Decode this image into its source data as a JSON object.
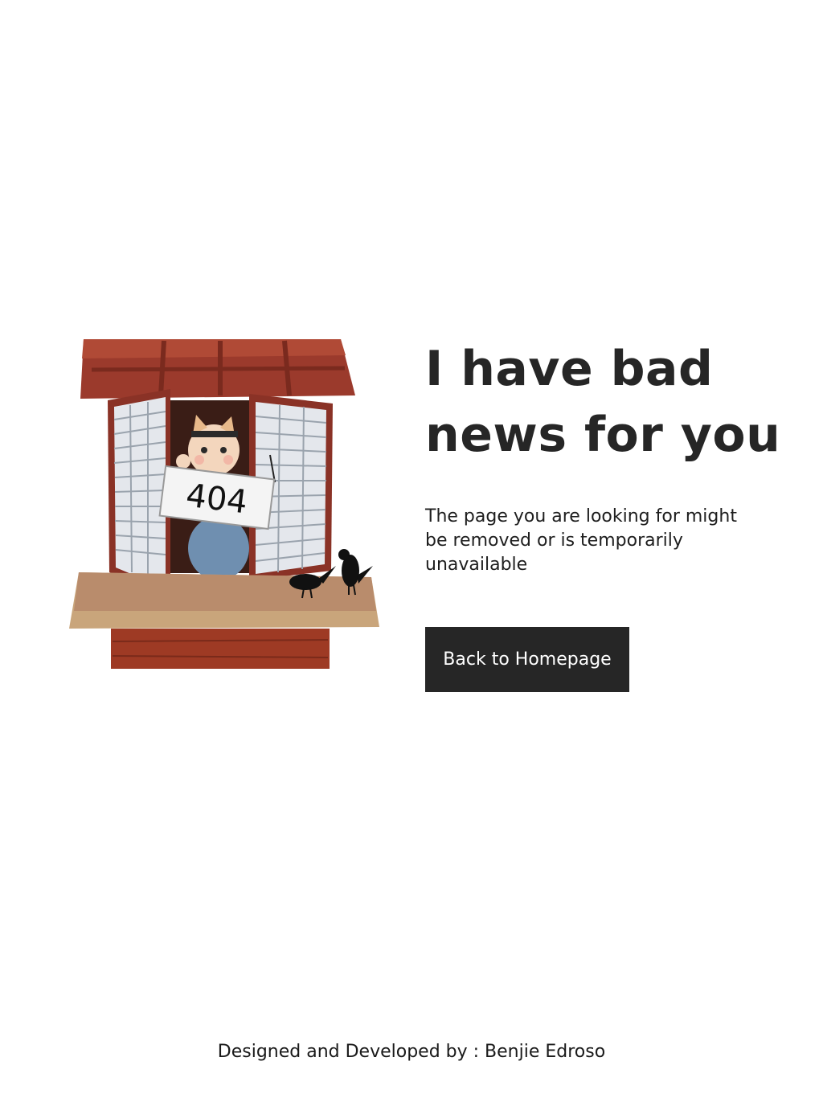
{
  "illustration": {
    "sign_text": "404"
  },
  "main": {
    "headline": "I have bad news for you",
    "message": "The page you are looking for might be removed or is temporarily unavailable",
    "button_label": "Back to Homepage"
  },
  "footer": {
    "credit": "Designed and Developed by : Benjie Edroso"
  },
  "colors": {
    "button_bg": "#262626",
    "button_text": "#ffffff",
    "text": "#262626"
  }
}
